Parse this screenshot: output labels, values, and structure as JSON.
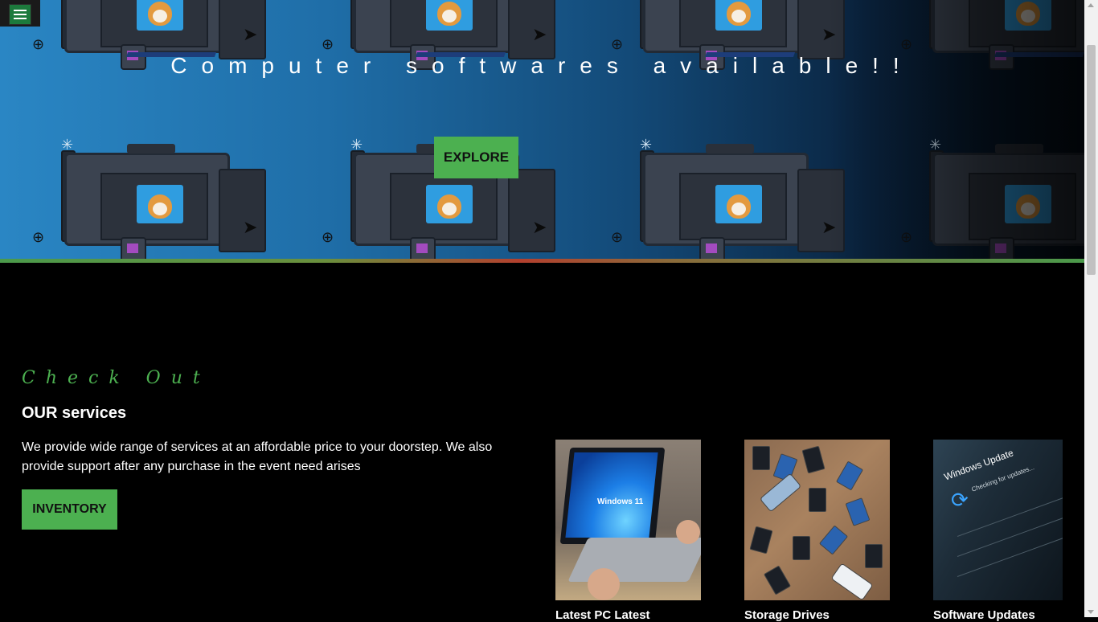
{
  "nav": {
    "menu_icon": "hamburger-icon"
  },
  "hero": {
    "title": "Computer softwares available!!",
    "explore_label": "EXPLORE"
  },
  "services": {
    "eyebrow": "Check Out",
    "heading": "OUR services",
    "description": "We provide wide range of services at an affordable price to your doorstep. We also provide support after any purchase in the event need arises",
    "inventory_label": "INVENTORY"
  },
  "cards": [
    {
      "image_text": "Windows 11",
      "caption": "Latest PC Latest"
    },
    {
      "image_text": "",
      "caption": "Storage Drives"
    },
    {
      "image_text": "Windows Update",
      "image_subtext": "Checking for updates...",
      "caption": "Software Updates"
    }
  ],
  "colors": {
    "accent_green": "#4cb050",
    "page_background": "#000000",
    "hero_blue": "#2a86c4"
  }
}
